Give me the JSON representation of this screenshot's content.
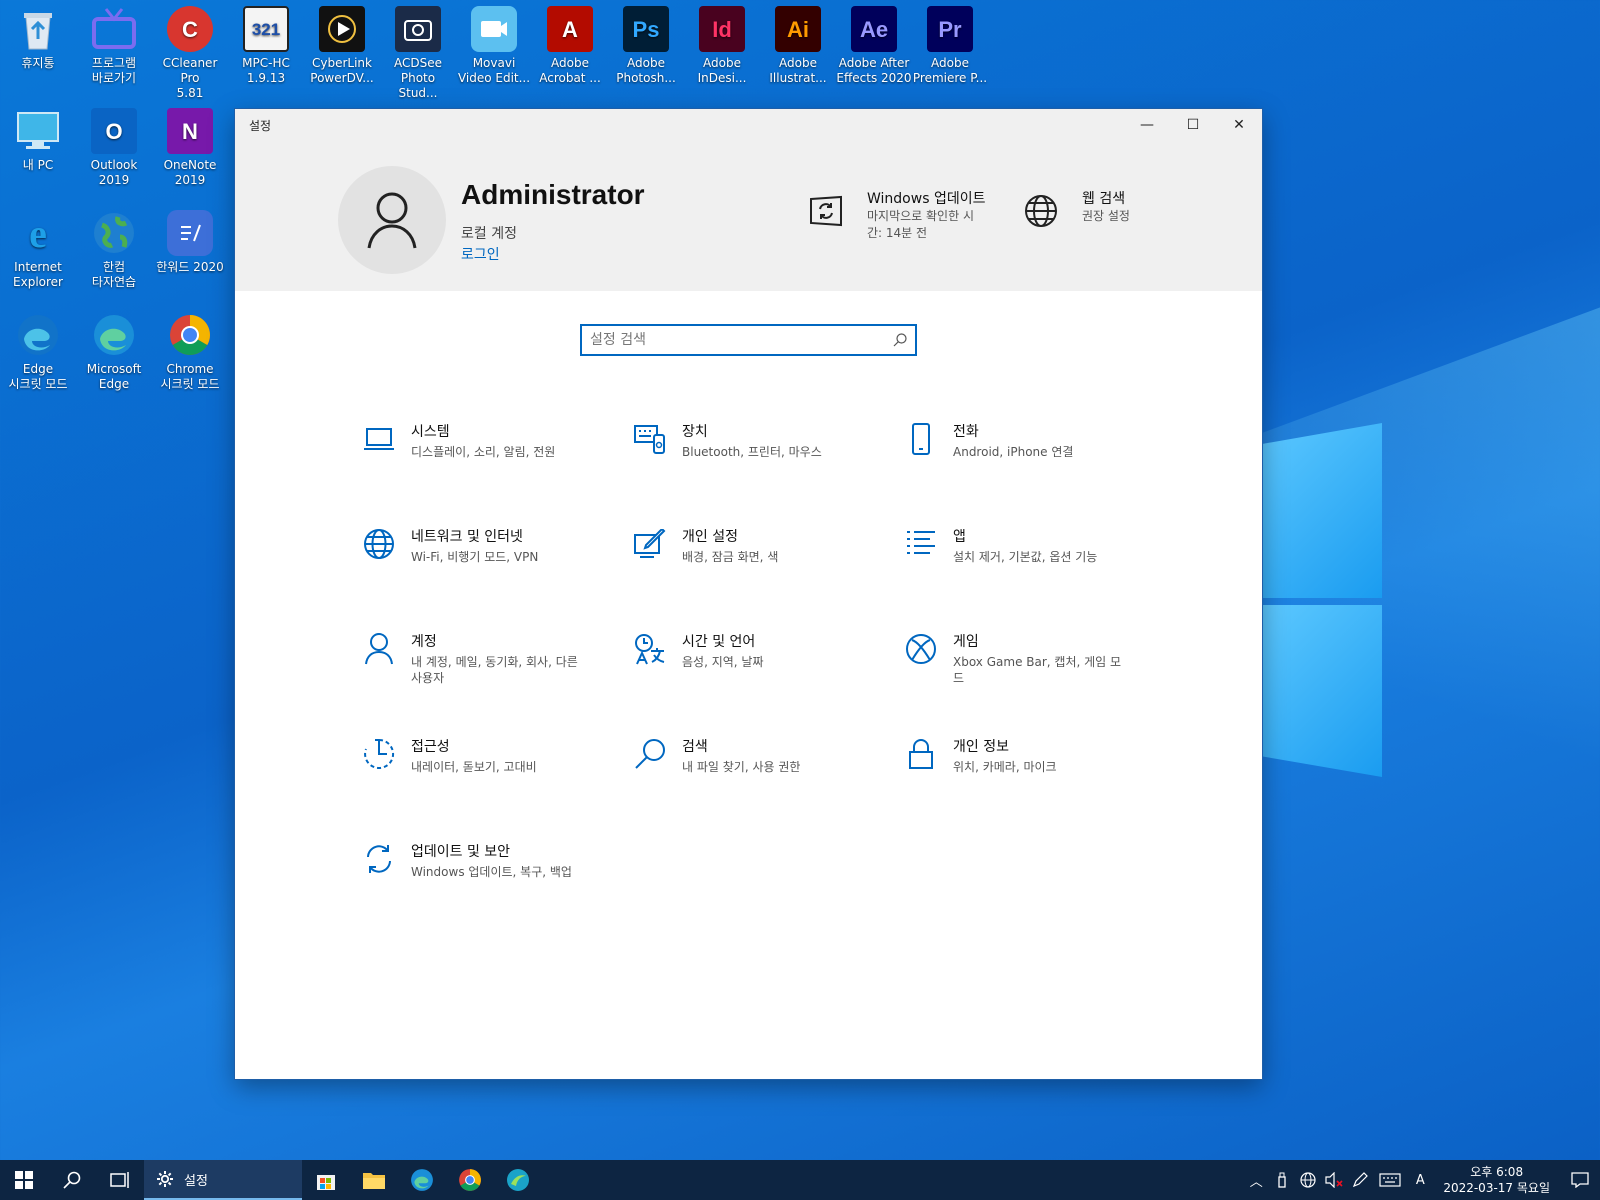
{
  "desktop": {
    "icons": [
      {
        "label": "휴지통",
        "icon": "recycle-bin-icon",
        "color": "#3a8fd9"
      },
      {
        "label": "프로그램\n바로가기",
        "icon": "tv-shortcut-icon",
        "color": "#6b5be0"
      },
      {
        "label": "CCleaner Pro\n5.81",
        "icon": "ccleaner-icon",
        "color": "#d8362f"
      },
      {
        "label": "MPC-HC\n1.9.13",
        "icon": "mpc-hc-icon",
        "color": "#f0f0f0"
      },
      {
        "label": "CyberLink\nPowerDV...",
        "icon": "powerdvd-icon",
        "color": "#1a1a2e"
      },
      {
        "label": "ACDSee\nPhoto Stud...",
        "icon": "acdsee-icon",
        "color": "#1b2b48"
      },
      {
        "label": "Movavi\nVideo Edit...",
        "icon": "movavi-icon",
        "color": "#5cc0f0"
      },
      {
        "label": "Adobe\nAcrobat ...",
        "icon": "acrobat-icon",
        "color": "#b30b00"
      },
      {
        "label": "Adobe\nPhotosh...",
        "icon": "photoshop-icon",
        "color": "#001e36"
      },
      {
        "label": "Adobe\nInDesi...",
        "icon": "indesign-icon",
        "color": "#49021f"
      },
      {
        "label": "Adobe\nIllustrat...",
        "icon": "illustrator-icon",
        "color": "#330000"
      },
      {
        "label": "Adobe After\nEffects 2020",
        "icon": "after-effects-icon",
        "color": "#00005b"
      },
      {
        "label": "Adobe\nPremiere P...",
        "icon": "premiere-icon",
        "color": "#00005b"
      },
      {
        "label": "내 PC",
        "icon": "this-pc-icon",
        "color": "#3fb6e8"
      },
      {
        "label": "Outlook\n2019",
        "icon": "outlook-icon",
        "color": "#0a64c4"
      },
      {
        "label": "OneNote\n2019",
        "icon": "onenote-icon",
        "color": "#7719aa"
      },
      {
        "label": "Internet\nExplorer",
        "icon": "internet-explorer-icon",
        "color": "#1ea0e8"
      },
      {
        "label": "한컴\n타자연습",
        "icon": "globe-typing-icon",
        "color": "#2e8b57"
      },
      {
        "label": "한워드 2020",
        "icon": "hanword-icon",
        "color": "#3d6fd8"
      },
      {
        "label": "Edge\n시크릿 모드",
        "icon": "edge-private-icon",
        "color": "#1173c9"
      },
      {
        "label": "Microsoft\nEdge",
        "icon": "edge-icon",
        "color": "#1a8fd8"
      },
      {
        "label": "Chrome\n시크릿 모드",
        "icon": "chrome-icon",
        "color": "#e0e0e0"
      }
    ],
    "icon_glyphs": {
      "ccleaner": "C",
      "mpc": "321",
      "acrobat": "A",
      "photoshop": "Ps",
      "indesign": "Id",
      "illustrator": "Ai",
      "after_effects": "Ae",
      "premiere": "Pr",
      "outlook": "O",
      "onenote": "N",
      "ie": "e"
    }
  },
  "window": {
    "title": "설정",
    "minimize_glyph": "—",
    "maximize_glyph": "☐",
    "close_glyph": "✕"
  },
  "header": {
    "user_name": "Administrator",
    "account_type": "로컬 계정",
    "login_link": "로그인",
    "windows_update": {
      "title": "Windows 업데이트",
      "subtitle": "마지막으로 확인한 시간: 14분 전"
    },
    "web_search": {
      "title": "웹 검색",
      "subtitle": "권장 설정"
    }
  },
  "search": {
    "placeholder": "설정 검색",
    "value": ""
  },
  "categories": [
    {
      "title": "시스템",
      "subtitle": "디스플레이, 소리, 알림, 전원",
      "icon": "laptop-icon"
    },
    {
      "title": "장치",
      "subtitle": "Bluetooth, 프린터, 마우스",
      "icon": "devices-icon"
    },
    {
      "title": "전화",
      "subtitle": "Android, iPhone 연결",
      "icon": "phone-icon"
    },
    {
      "title": "네트워크 및 인터넷",
      "subtitle": "Wi-Fi, 비행기 모드, VPN",
      "icon": "globe-icon"
    },
    {
      "title": "개인 설정",
      "subtitle": "배경, 잠금 화면, 색",
      "icon": "personalization-icon"
    },
    {
      "title": "앱",
      "subtitle": "설치 제거, 기본값, 옵션 기능",
      "icon": "apps-list-icon"
    },
    {
      "title": "계정",
      "subtitle": "내 계정, 메일, 동기화, 회사, 다른 사용자",
      "icon": "person-icon"
    },
    {
      "title": "시간 및 언어",
      "subtitle": "음성, 지역, 날짜",
      "icon": "time-language-icon"
    },
    {
      "title": "게임",
      "subtitle": "Xbox Game Bar, 캡처, 게임 모드",
      "icon": "xbox-icon"
    },
    {
      "title": "접근성",
      "subtitle": "내레이터, 돋보기, 고대비",
      "icon": "ease-of-access-icon"
    },
    {
      "title": "검색",
      "subtitle": "내 파일 찾기, 사용 권한",
      "icon": "search-icon"
    },
    {
      "title": "개인 정보",
      "subtitle": "위치, 카메라, 마이크",
      "icon": "lock-icon"
    },
    {
      "title": "업데이트 및 보안",
      "subtitle": "Windows 업데이트, 복구, 백업",
      "icon": "sync-icon"
    }
  ],
  "taskbar": {
    "active_app_label": "설정",
    "ime_label": "A",
    "time": "오후 6:08",
    "date": "2022-03-17 목요일"
  },
  "colors": {
    "accent": "#0067c0",
    "taskbar": "#0d2542"
  }
}
